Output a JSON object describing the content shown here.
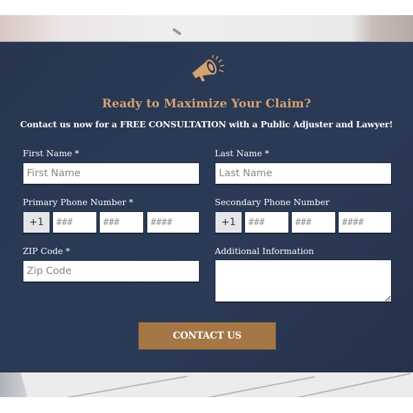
{
  "header": {
    "icon": "megaphone-icon",
    "title": "Ready to Maximize Your Claim?",
    "subtitle": "Contact us now for a FREE CONSULTATION with a Public Adjuster and Lawyer!"
  },
  "form": {
    "first_name": {
      "label": "First Name *",
      "placeholder": "First Name",
      "value": ""
    },
    "last_name": {
      "label": "Last Name *",
      "placeholder": "Last Name",
      "value": ""
    },
    "primary_phone": {
      "label": "Primary Phone Number *",
      "country_code": "+1",
      "parts": [
        {
          "placeholder": "###"
        },
        {
          "placeholder": "###"
        },
        {
          "placeholder": "####"
        }
      ]
    },
    "secondary_phone": {
      "label": "Secondary Phone Number",
      "country_code": "+1",
      "parts": [
        {
          "placeholder": "###"
        },
        {
          "placeholder": "###"
        },
        {
          "placeholder": "####"
        }
      ]
    },
    "zip_code": {
      "label": "ZIP Code *",
      "placeholder": "Zip Code",
      "value": ""
    },
    "additional_info": {
      "label": "Additional Information",
      "value": ""
    },
    "submit_label": "CONTACT US"
  },
  "colors": {
    "panel_background": "#2a3a55",
    "accent_gold": "#d4a373",
    "button_background": "#a57746",
    "text_white": "#ffffff"
  }
}
